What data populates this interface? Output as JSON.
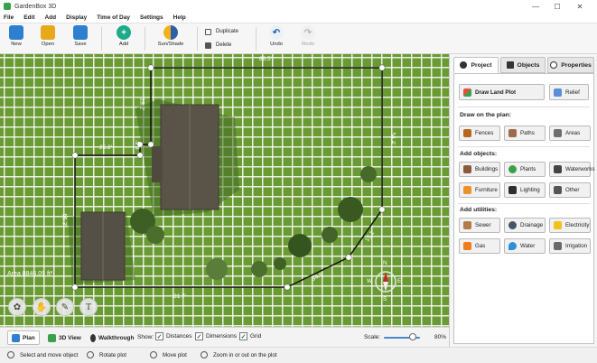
{
  "window": {
    "title": "GardenBox 3D",
    "controls": {
      "minimize": "—",
      "maximize": "☐",
      "close": "✕"
    }
  },
  "menu": [
    "File",
    "Edit",
    "Add",
    "Display",
    "Time of Day",
    "Settings",
    "Help"
  ],
  "toolbar": {
    "new": "New",
    "open": "Open",
    "save": "Save",
    "add": "Add",
    "sun_shade": "Sun/Shade",
    "duplicate": "Duplicate",
    "delete": "Delete",
    "undo": "Undo",
    "redo": "Redo"
  },
  "canvas": {
    "dimensions": {
      "top": "86.5'",
      "upper_right": "54.4'",
      "left_step_vertical": "28.2'",
      "left_step_horizontal": "25.2'",
      "step_small": "6.5'",
      "left": "56.3'",
      "bottom": "31.7'",
      "bottom_right": "34.8'",
      "right_diag": "15.1'"
    },
    "area": "Area 8846.09 ft²",
    "compass": {
      "n": "N",
      "s": "S",
      "e": "E",
      "w": "W"
    },
    "tools": {
      "text": "T"
    }
  },
  "viewbar": {
    "plan": "Plan",
    "view3d": "3D View",
    "walkthrough": "Walkthrough",
    "show": "Show:",
    "distances": "Distances",
    "dimensions": "Dimensions",
    "grid": "Grid",
    "check_glyph": "✓",
    "scale_label": "Scale:",
    "scale_value": "80%",
    "scale_fraction": 0.8
  },
  "status": {
    "select": "Select and move object",
    "rotate": "Rotate plot",
    "move": "Move plot",
    "zoom": "Zoom in or out on the plot"
  },
  "panel": {
    "tabs": {
      "project": "Project",
      "objects": "Objects",
      "properties": "Properties"
    },
    "draw_land_plot": "Draw Land Plot",
    "relief": "Relief",
    "draw_on_plan": "Draw on the plan:",
    "fences": "Fences",
    "paths": "Paths",
    "areas": "Areas",
    "add_objects": "Add objects:",
    "buildings": "Buildings",
    "plants": "Plants",
    "waterworks": "Waterworks",
    "furniture": "Furniture",
    "lighting": "Lighting",
    "other": "Other",
    "add_utilities": "Add utilities:",
    "sewer": "Sewer",
    "drainage": "Drainage",
    "electricity": "Electricity",
    "gas": "Gas",
    "water": "Water",
    "irrigation": "Irrigation"
  },
  "colors": {
    "grass": "#6a9a33",
    "accent_green": "#3aa14a",
    "accent_blue": "#2f7fd0",
    "folder_yellow": "#e8a81c"
  }
}
